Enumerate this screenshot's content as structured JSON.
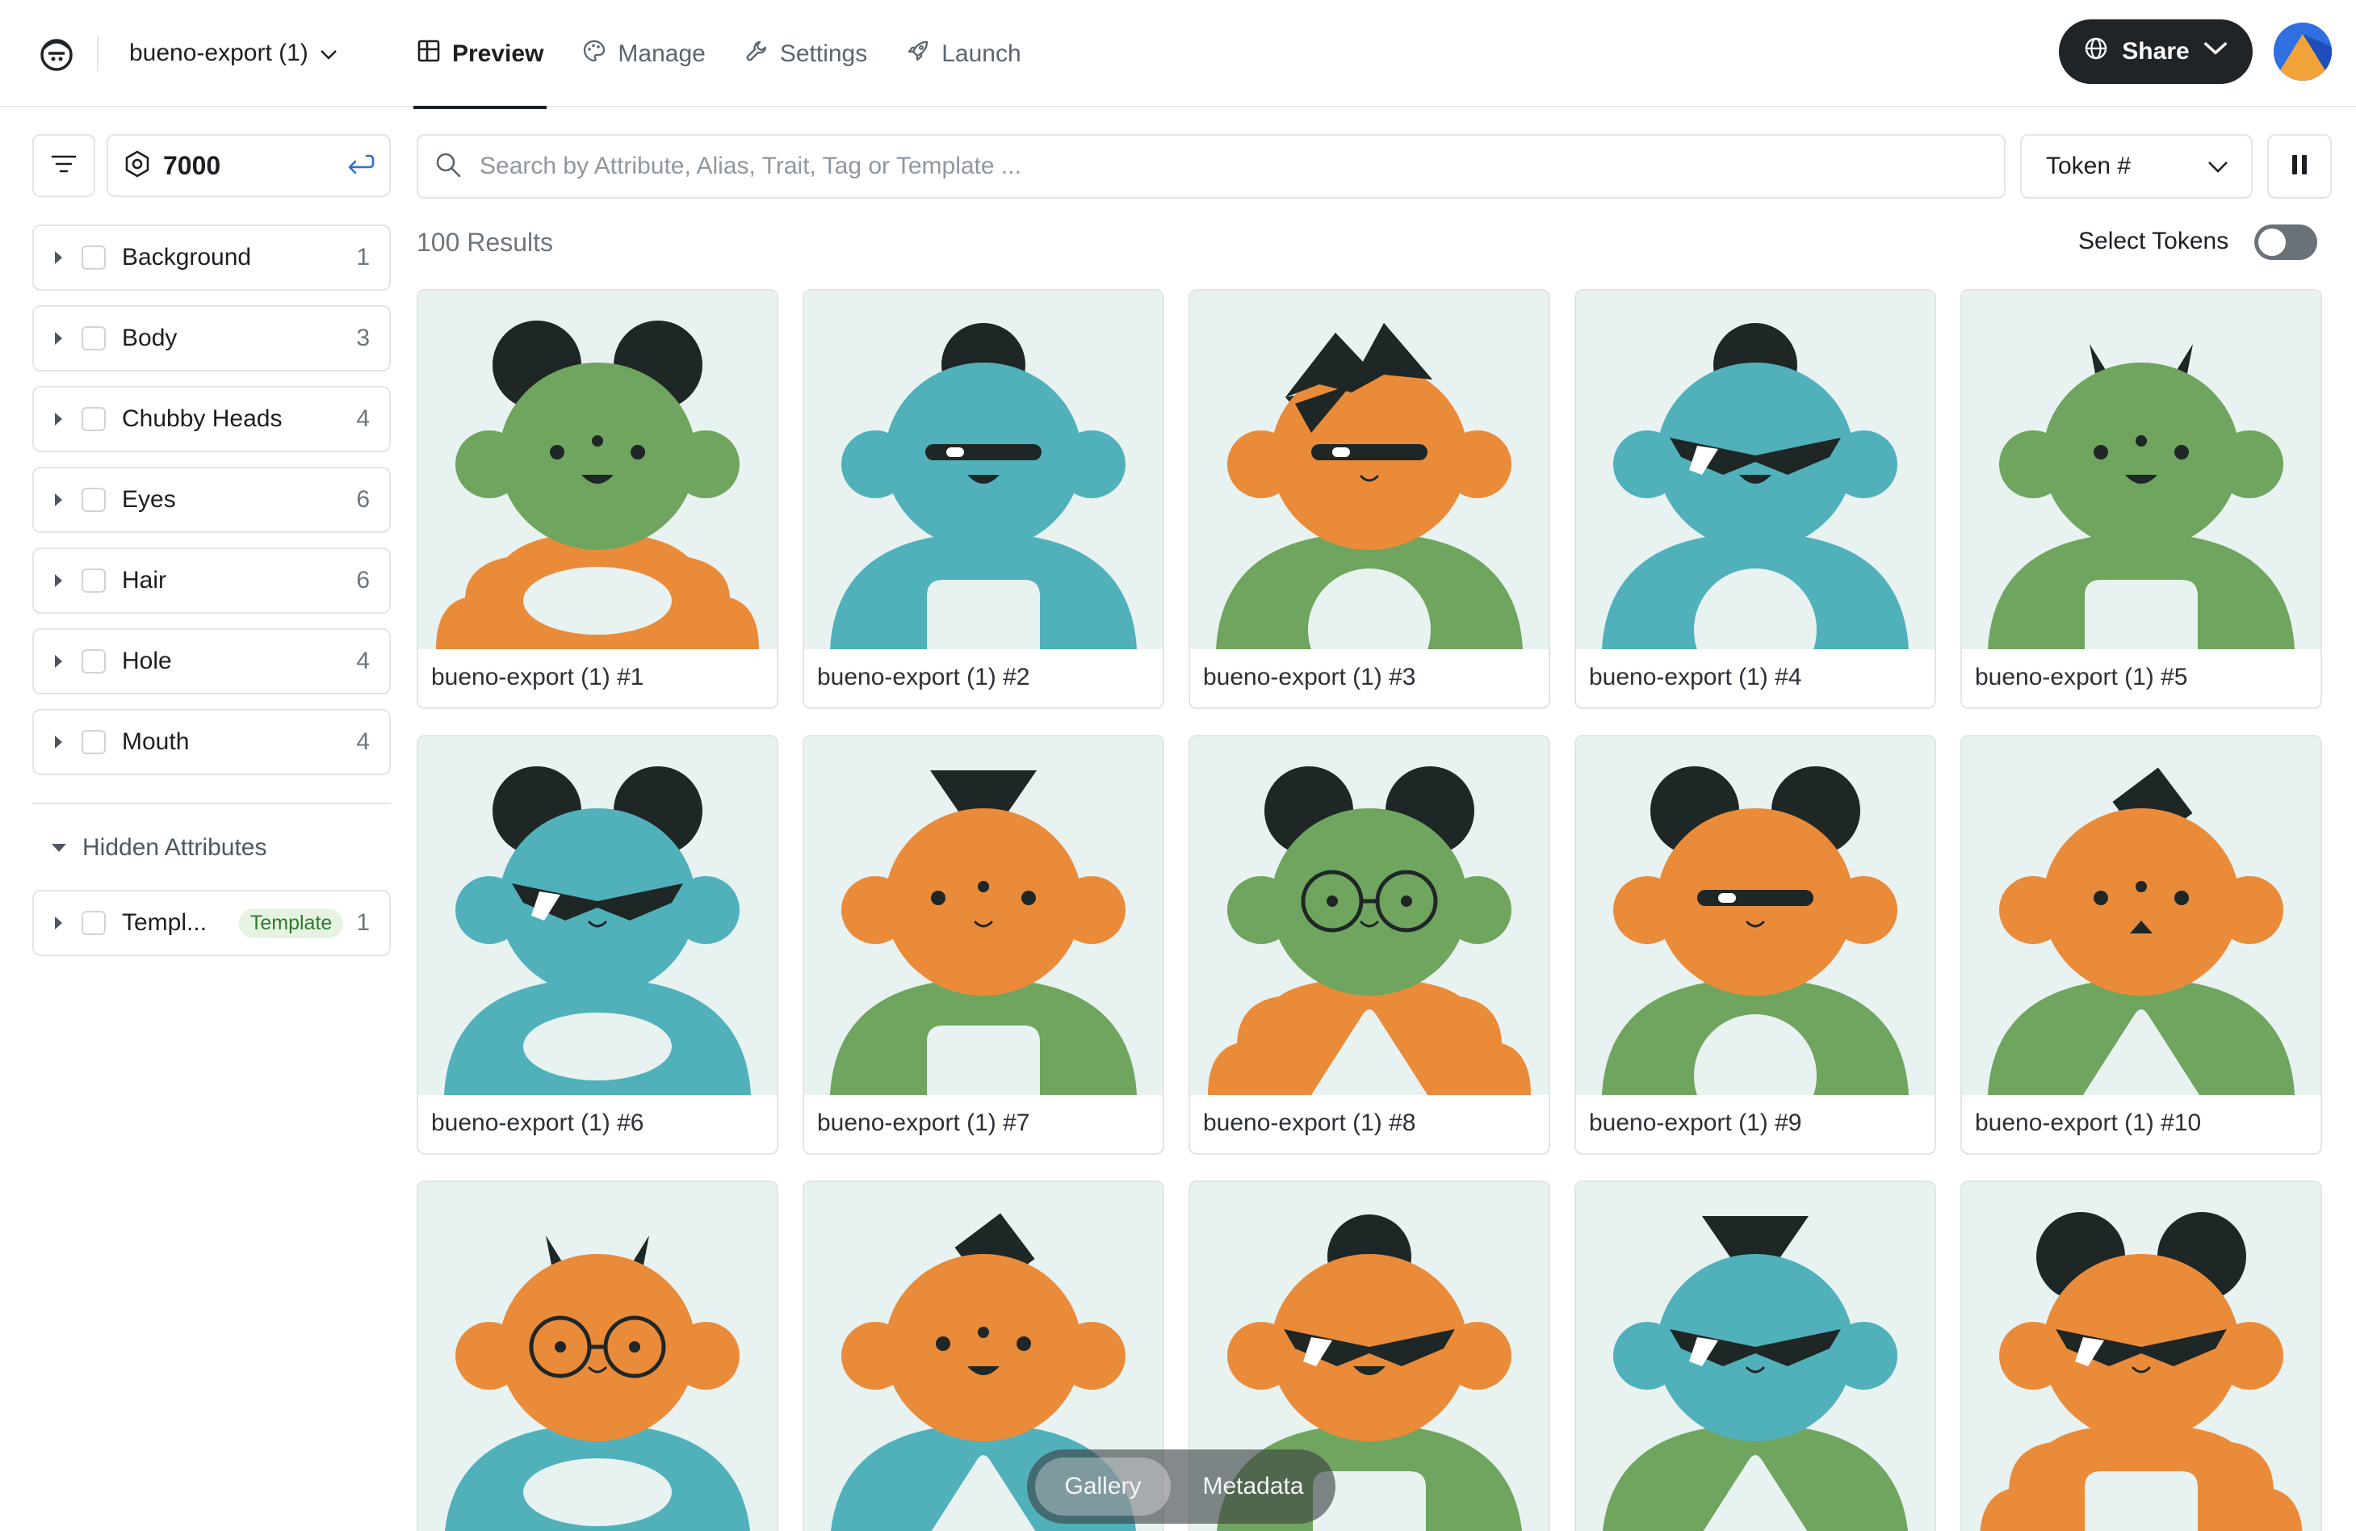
{
  "header": {
    "project_name": "bueno-export (1)",
    "tabs": [
      {
        "label": "Preview",
        "icon": "grid-icon",
        "active": true
      },
      {
        "label": "Manage",
        "icon": "palette-icon",
        "active": false
      },
      {
        "label": "Settings",
        "icon": "wrench-icon",
        "active": false
      },
      {
        "label": "Launch",
        "icon": "rocket-icon",
        "active": false
      }
    ],
    "share_label": "Share"
  },
  "sidebar": {
    "supply_value": "7000",
    "attributes": [
      {
        "name": "Background",
        "count": "1"
      },
      {
        "name": "Body",
        "count": "3"
      },
      {
        "name": "Chubby Heads",
        "count": "4"
      },
      {
        "name": "Eyes",
        "count": "6"
      },
      {
        "name": "Hair",
        "count": "6"
      },
      {
        "name": "Hole",
        "count": "4"
      },
      {
        "name": "Mouth",
        "count": "4"
      }
    ],
    "hidden_attributes_label": "Hidden Attributes",
    "hidden_attributes": [
      {
        "name": "Templ...",
        "badge": "Template",
        "count": "1"
      }
    ]
  },
  "toolbar": {
    "search_placeholder": "Search by Attribute, Alias, Trait, Tag or Template ...",
    "sort_label": "Token #"
  },
  "results_label": "100 Results",
  "select_tokens_label": "Select Tokens",
  "colors": {
    "orange": "#ea8b3a",
    "teal": "#50b1bb",
    "green": "#6fa55e",
    "dark": "#1f2626",
    "card_bg": "#e8f2f1"
  },
  "tokens": [
    {
      "label": "bueno-export (1) #1",
      "head": "green",
      "body": "orange",
      "hair": "ears",
      "eyes": "dots",
      "mouth": "smile",
      "hole": "oval"
    },
    {
      "label": "bueno-export (1) #2",
      "head": "teal",
      "body": "teal",
      "hair": "bun",
      "eyes": "visor",
      "mouth": "smile",
      "hole": "arch"
    },
    {
      "label": "bueno-export (1) #3",
      "head": "orange",
      "body": "green",
      "hair": "spiky",
      "eyes": "visor",
      "mouth": "smirk",
      "hole": "circle"
    },
    {
      "label": "bueno-export (1) #4",
      "head": "teal",
      "body": "teal",
      "hair": "bun",
      "eyes": "shades",
      "mouth": "smile",
      "hole": "circle"
    },
    {
      "label": "bueno-export (1) #5",
      "head": "green",
      "body": "green",
      "hair": "horns",
      "eyes": "dots",
      "mouth": "smile",
      "hole": "arch"
    },
    {
      "label": "bueno-export (1) #6",
      "head": "teal",
      "body": "teal",
      "hair": "ears",
      "eyes": "shades",
      "mouth": "smirk",
      "hole": "oval"
    },
    {
      "label": "bueno-export (1) #7",
      "head": "orange",
      "body": "green",
      "hair": "triangle",
      "eyes": "three-dots",
      "mouth": "smirk",
      "hole": "arch"
    },
    {
      "label": "bueno-export (1) #8",
      "head": "green",
      "body": "orange",
      "hair": "ears",
      "eyes": "glasses",
      "mouth": "smirk",
      "hole": "triangle"
    },
    {
      "label": "bueno-export (1) #9",
      "head": "orange",
      "body": "green",
      "hair": "ears",
      "eyes": "visor",
      "mouth": "smirk",
      "hole": "circle"
    },
    {
      "label": "bueno-export (1) #10",
      "head": "orange",
      "body": "green",
      "hair": "diamond",
      "eyes": "dots",
      "mouth": "frown",
      "hole": "triangle"
    },
    {
      "label": "",
      "head": "orange",
      "body": "teal",
      "hair": "horns",
      "eyes": "glasses",
      "mouth": "smirk",
      "hole": "oval"
    },
    {
      "label": "",
      "head": "orange",
      "body": "teal",
      "hair": "diamond",
      "eyes": "dots",
      "mouth": "smile",
      "hole": "triangle"
    },
    {
      "label": "",
      "head": "orange",
      "body": "green",
      "hair": "bun",
      "eyes": "shades",
      "mouth": "smile",
      "hole": "arch"
    },
    {
      "label": "",
      "head": "teal",
      "body": "green",
      "hair": "triangle",
      "eyes": "shades",
      "mouth": "smirk",
      "hole": "triangle"
    },
    {
      "label": "",
      "head": "orange",
      "body": "orange",
      "hair": "ears",
      "eyes": "shades",
      "mouth": "smirk",
      "hole": "arch"
    }
  ],
  "view_switch": {
    "gallery_label": "Gallery",
    "metadata_label": "Metadata"
  }
}
